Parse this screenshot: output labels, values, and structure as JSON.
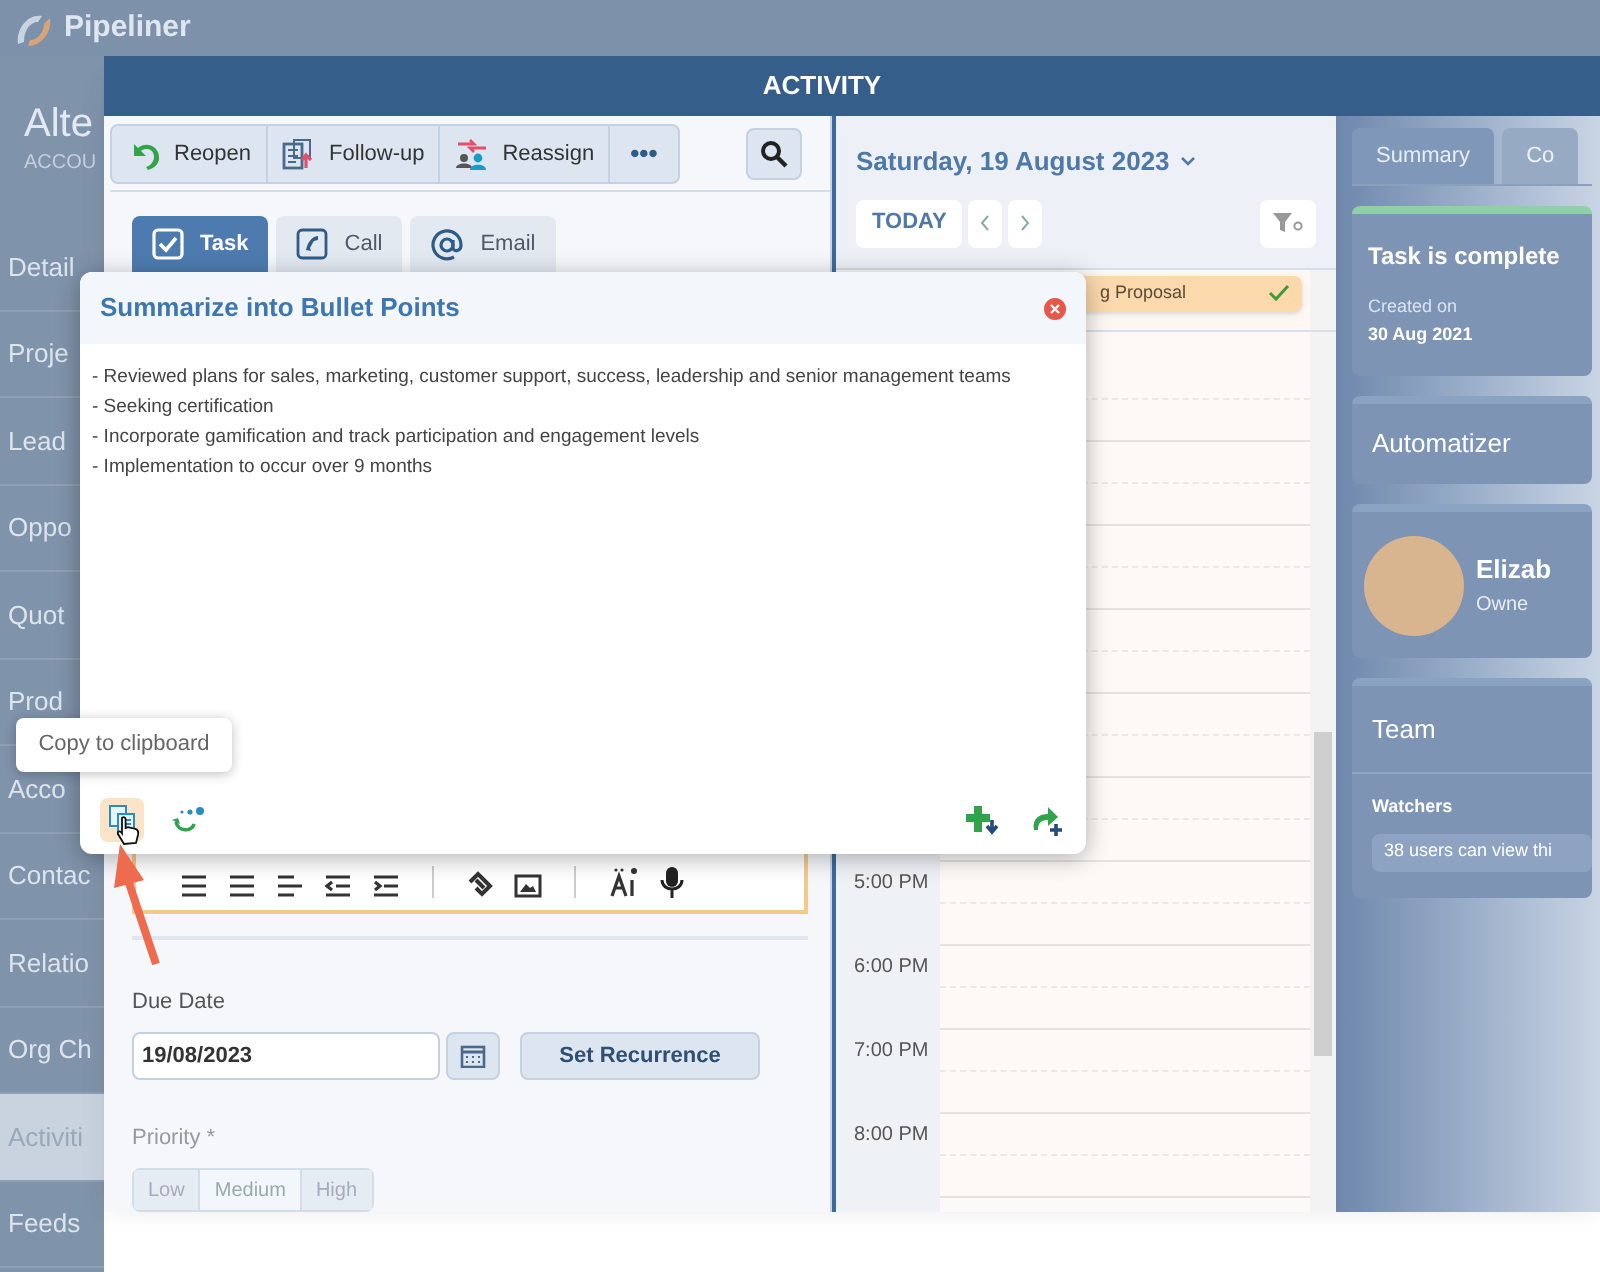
{
  "app": {
    "logo_text": "Pipeliner",
    "record_title": "Alte",
    "record_type": "ACCOU",
    "nav": [
      {
        "label": "Detail",
        "selected": false
      },
      {
        "label": "Proje",
        "selected": false
      },
      {
        "label": "Lead",
        "selected": false
      },
      {
        "label": "Oppo",
        "selected": false
      },
      {
        "label": "Quot",
        "selected": false
      },
      {
        "label": "Prod",
        "selected": false
      },
      {
        "label": "Acco",
        "selected": false
      },
      {
        "label": "Contac",
        "selected": false
      },
      {
        "label": "Relatio",
        "selected": false
      },
      {
        "label": "Org Ch",
        "selected": false
      },
      {
        "label": "Activiti",
        "selected": true
      },
      {
        "label": "Feeds",
        "selected": false
      }
    ]
  },
  "window": {
    "title": "ACTIVITY"
  },
  "toolbar": [
    {
      "kind": "reopen",
      "label": "Reopen"
    },
    {
      "kind": "follow-up",
      "label": "Follow-up"
    },
    {
      "kind": "reassign",
      "label": "Reassign"
    },
    {
      "kind": "more",
      "label": "•••"
    }
  ],
  "activity_tabs": [
    {
      "kind": "task",
      "label": "Task",
      "selected": true
    },
    {
      "kind": "call",
      "label": "Call",
      "selected": false
    },
    {
      "kind": "email",
      "label": "Email",
      "selected": false
    }
  ],
  "form": {
    "due_date": {
      "label": "Due Date",
      "value": "19/08/2023"
    },
    "recurrence_button": "Set Recurrence",
    "priority": {
      "label": "Priority *",
      "options": [
        {
          "label": "Low",
          "selected": false
        },
        {
          "label": "Medium",
          "selected": true
        },
        {
          "label": "High",
          "selected": false
        }
      ]
    }
  },
  "calendar": {
    "date": "Saturday, 19 August 2023",
    "today_button": "TODAY",
    "event": {
      "title": "g Proposal",
      "done": true
    },
    "hours": [
      "5:00 PM",
      "6:00 PM",
      "7:00 PM",
      "8:00 PM"
    ]
  },
  "summary_panel": {
    "tabs": [
      {
        "label": "Summary",
        "selected": true
      },
      {
        "label": "Co",
        "selected": false
      }
    ],
    "status_card": {
      "title": "Task is complete",
      "created_label": "Created on",
      "created_date": "30 Aug 2021"
    },
    "automatizer": "Automatizer",
    "owner": {
      "name": "Elizab",
      "role": "Owne"
    },
    "team": {
      "title": "Team",
      "watchers_label": "Watchers",
      "watchers_text": "38 users can view thi"
    }
  },
  "popup": {
    "title": "Summarize into Bullet Points",
    "lines": [
      "- Reviewed plans for sales, marketing, customer support, success, leadership and senior management teams",
      "- Seeking certification",
      "- Incorporate gamification and track participation and engagement levels",
      "- Implementation to occur over 9 months"
    ],
    "tooltip": "Copy to clipboard"
  }
}
